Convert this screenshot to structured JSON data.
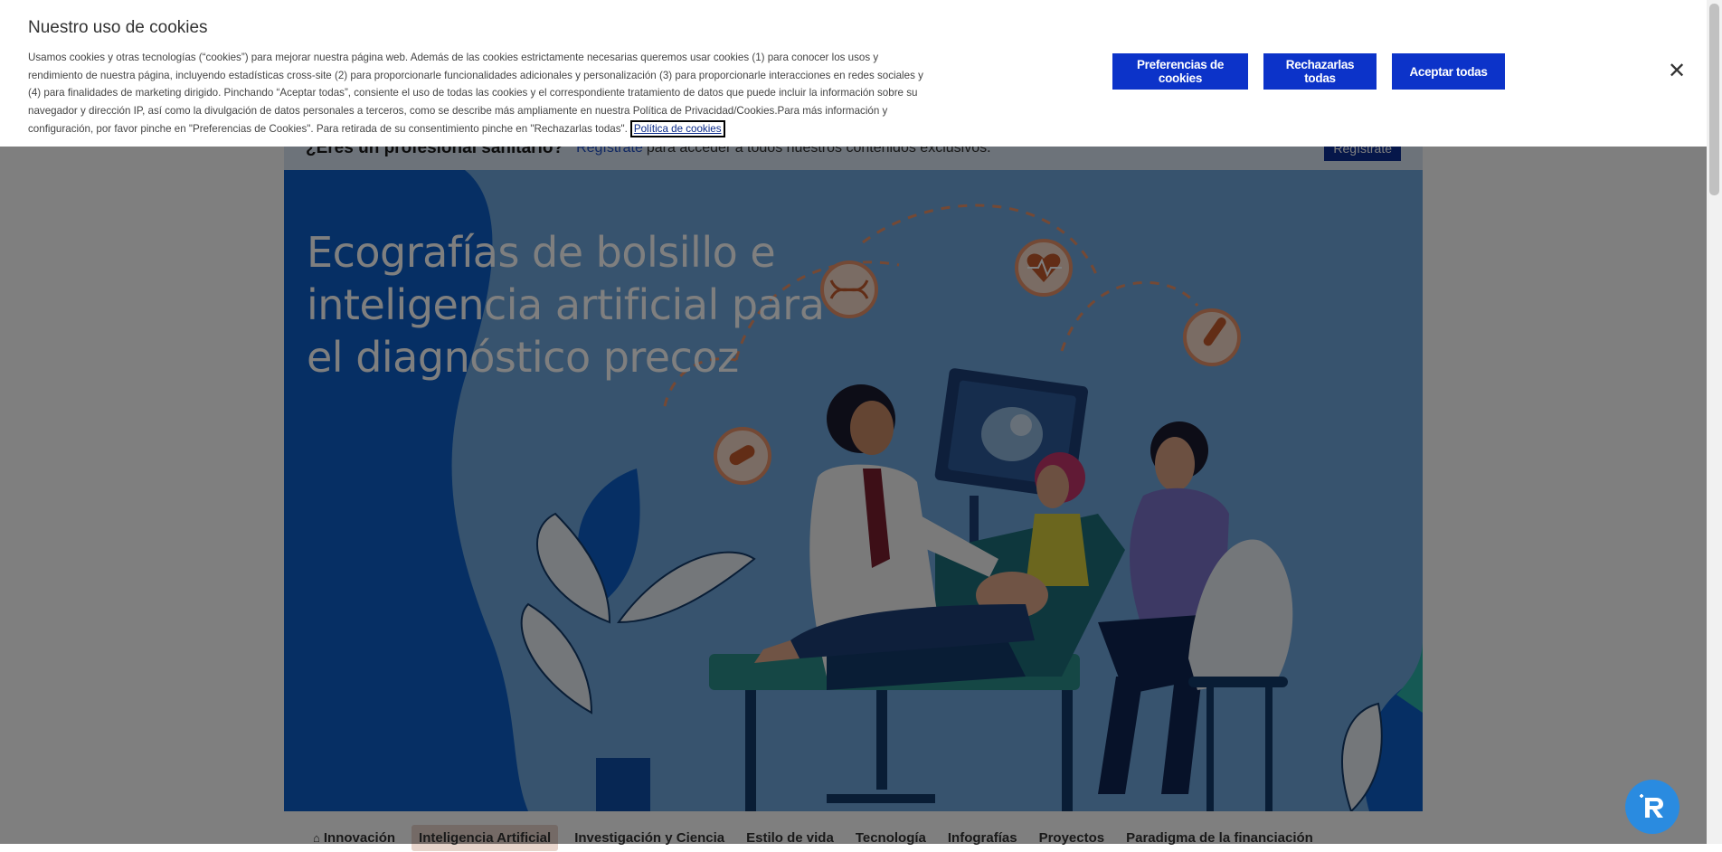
{
  "cookie_banner": {
    "title": "Nuestro uso de cookies",
    "body": "Usamos cookies y otras tecnologías (“cookies”) para mejorar nuestra página web. Además de las cookies estrictamente necesarias queremos usar cookies (1) para conocer los usos y rendimiento de nuestra página, incluyendo estadísticas cross-site (2) para proporcionarle funcionalidades adicionales y personalización (3) para proporcionarle interacciones en redes sociales y (4) para finalidades de marketing dirigido. Pinchando “Aceptar todas”, consiente el uso de todas las cookies y el correspondiente tratamiento de datos que puede incluir la información sobre su navegador y dirección IP, así como la divulgación de datos personales a terceros, como se describe más ampliamente en nuestra Política de Privacidad/Cookies.Para más información y configuración, por favor pinche en \"Preferencias de Cookies\". Para retirada de su consentimiento pinche en \"Rechazarlas todas\".",
    "policy_link": "Política de cookies",
    "preferences_button": "Preferencias de cookies",
    "reject_button": "Rechazarlas todas",
    "accept_button": "Aceptar todas",
    "close_icon": "close-icon",
    "button_color": "#0c33c9"
  },
  "professional_bar": {
    "question": "¿Eres un profesional sanitario?",
    "link": "Regístrate",
    "text": "para acceder a todos nuestros contenidos exclusivos.",
    "button": "Regístrate"
  },
  "hero": {
    "title": "Ecografías de bolsillo e inteligencia artificial para el diagnóstico precoz"
  },
  "nav": {
    "items": [
      {
        "label": "Innovación",
        "icon": "home-icon"
      },
      {
        "label": "Inteligencia Artificial",
        "active": true
      },
      {
        "label": "Investigación y Ciencia"
      },
      {
        "label": "Estilo de vida"
      },
      {
        "label": "Tecnología"
      },
      {
        "label": "Infografías"
      },
      {
        "label": "Proyectos"
      },
      {
        "label": "Paradigma de la financiación"
      }
    ]
  },
  "chat_widget": {
    "icon": "chat-bot-icon",
    "color": "#2a8be0"
  }
}
